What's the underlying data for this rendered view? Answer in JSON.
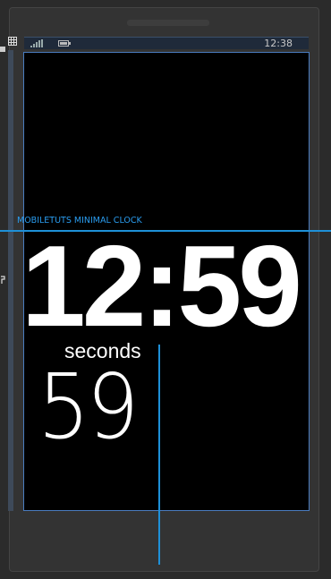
{
  "status_bar": {
    "time": "12:38",
    "signal_icon": "signal-bars-icon",
    "battery_icon": "battery-icon"
  },
  "app": {
    "title": "MOBILETUTS MINIMAL CLOCK",
    "clock_time": "12:59",
    "seconds_label": "seconds",
    "seconds_value": "59"
  },
  "designer": {
    "grid_icon": "grid-icon",
    "guide_color": "#1e90d8",
    "screen_border_color": "#4a7cbf"
  },
  "colors": {
    "screen_background": "#000000",
    "text": "#ffffff",
    "accent": "#2a9df0",
    "chrome": "#2b2b2b"
  }
}
